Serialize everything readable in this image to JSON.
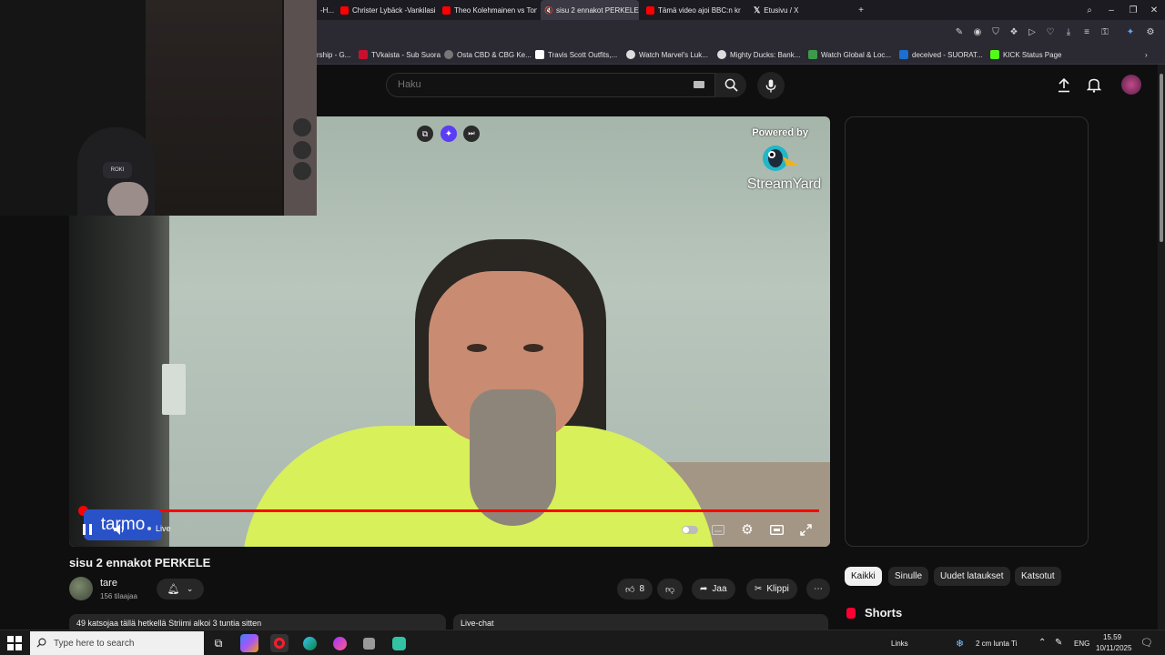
{
  "browser": {
    "tabs": [
      {
        "label": "-H...",
        "color": "#cc2222"
      },
      {
        "label": "Christer Lybäck -Vankilasi",
        "color": "#ff0000"
      },
      {
        "label": "Theo Kolehmainen vs Toni",
        "color": "#ff0000"
      },
      {
        "label": "sisu 2 ennakot PERKELE",
        "color": "#ff0000",
        "active": true
      },
      {
        "label": "Tämä video ajoi BBC:n kri",
        "color": "#ff0000"
      },
      {
        "label": "Etusivu / X",
        "color": "#000000"
      }
    ],
    "bookmarks": [
      {
        "label": "rship - G...",
        "color": "#888888"
      },
      {
        "label": "TVkaista - Sub Suora",
        "color": "#c8102e"
      },
      {
        "label": "Osta CBD & CBG Ke...",
        "color": "#777777"
      },
      {
        "label": "Travis Scott Outfits,...",
        "color": "#ffffff"
      },
      {
        "label": "Watch Marvel's Luk...",
        "color": "#dddddd"
      },
      {
        "label": "Mighty Ducks: Bank...",
        "color": "#dddddd"
      },
      {
        "label": "Watch Global & Loc...",
        "color": "#3b9b4a"
      },
      {
        "label": "deceived - SUORAT...",
        "color": "#1a6fd1"
      },
      {
        "label": "KICK Status Page",
        "color": "#53fc18"
      }
    ]
  },
  "search": {
    "placeholder": "Haku"
  },
  "player": {
    "overlay_powered": "Powered by",
    "overlay_brand": "StreamYard",
    "name_badge": "tarmo",
    "live_label": "Live",
    "progress": 1.0
  },
  "video": {
    "title": "sisu 2 ennakot PERKELE",
    "channel": "tare",
    "subscribers": "156 tilaajaa",
    "likes": "8",
    "share_label": "Jaa",
    "clip_label": "Klippi",
    "description": "49 katsojaa tällä hetkellä  Striimi alkoi 3 tuntia sitten",
    "live_chat": "Live-chat"
  },
  "chips": [
    "Kaikki",
    "Sinulle",
    "Uudet lataukset",
    "Katsotut"
  ],
  "shorts_label": "Shorts",
  "taskbar": {
    "search_placeholder": "Type here to search",
    "links": "Links",
    "weather": "2 cm lunta Ti",
    "lang": "ENG",
    "time": "15.59",
    "date": "10/11/2025"
  },
  "colors": {
    "accent": "#ff0000",
    "badge": "#2a52c8",
    "shirt": "#d8f05a"
  }
}
